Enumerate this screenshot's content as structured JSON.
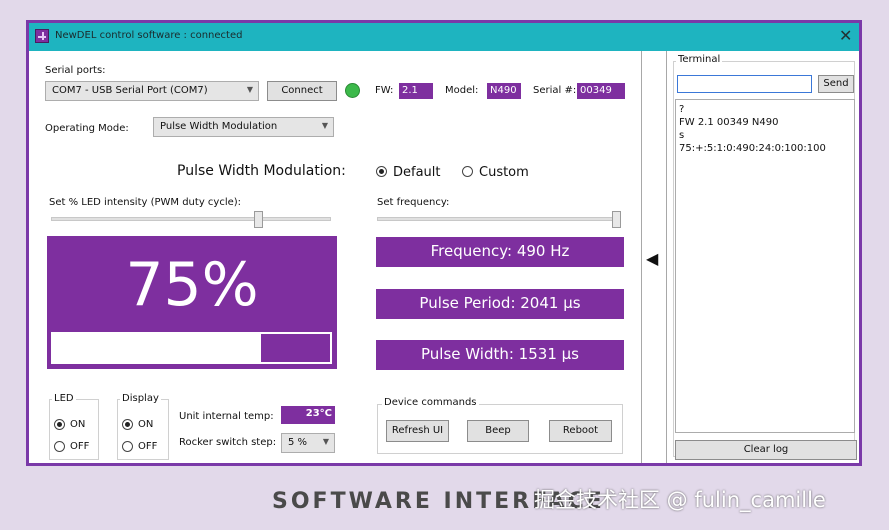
{
  "window": {
    "title": "NewDEL control software : connected",
    "close_label": "✕"
  },
  "serial": {
    "label": "Serial ports:",
    "port_value": "COM7 - USB Serial Port (COM7)",
    "connect_label": "Connect",
    "status_color": "#3cb94a",
    "fw_label": "FW:",
    "fw_value": "2.1",
    "model_label": "Model:",
    "model_value": "N490",
    "serial_label": "Serial #:",
    "serial_value": "00349"
  },
  "mode": {
    "label": "Operating Mode:",
    "value": "Pulse Width Modulation"
  },
  "pwm": {
    "heading": "Pulse Width Modulation:",
    "option_default": "Default",
    "option_custom": "Custom",
    "selected": "Default",
    "intensity_label": "Set % LED intensity (PWM duty cycle):",
    "intensity_fraction": 0.75,
    "intensity_display": "75%",
    "frequency_label": "Set frequency:",
    "frequency_slider_fraction": 1.0,
    "frequency_text": "Frequency: 490 Hz",
    "period_text": "Pulse Period: 2041 µs",
    "width_text": "Pulse Width: 1531 µs"
  },
  "led_group": {
    "title": "LED",
    "on_label": "ON",
    "off_label": "OFF",
    "selected": "ON"
  },
  "display_group": {
    "title": "Display",
    "on_label": "ON",
    "off_label": "OFF",
    "selected": "ON"
  },
  "status": {
    "temp_label": "Unit internal temp:",
    "temp_value": "23°C",
    "rocker_label": "Rocker switch step:",
    "rocker_value": "5 %"
  },
  "commands": {
    "title": "Device commands",
    "refresh_label": "Refresh UI",
    "beep_label": "Beep",
    "reboot_label": "Reboot"
  },
  "splitter": {
    "arrow": "◀"
  },
  "terminal": {
    "title": "Terminal",
    "input_value": "",
    "send_label": "Send",
    "log_lines": [
      "?",
      "FW 2.1 00349 N490",
      "s",
      "75:+:5:1:0:490:24:0:100:100"
    ],
    "clear_label": "Clear log"
  },
  "colors": {
    "accent": "#7e2f9f",
    "titlebar": "#1eb4c0",
    "frame": "#7a39a8"
  },
  "caption": {
    "footer_text": "SOFTWARE INTERFACE",
    "watermark_text": "掘金技术社区 @ fulin_camille"
  }
}
